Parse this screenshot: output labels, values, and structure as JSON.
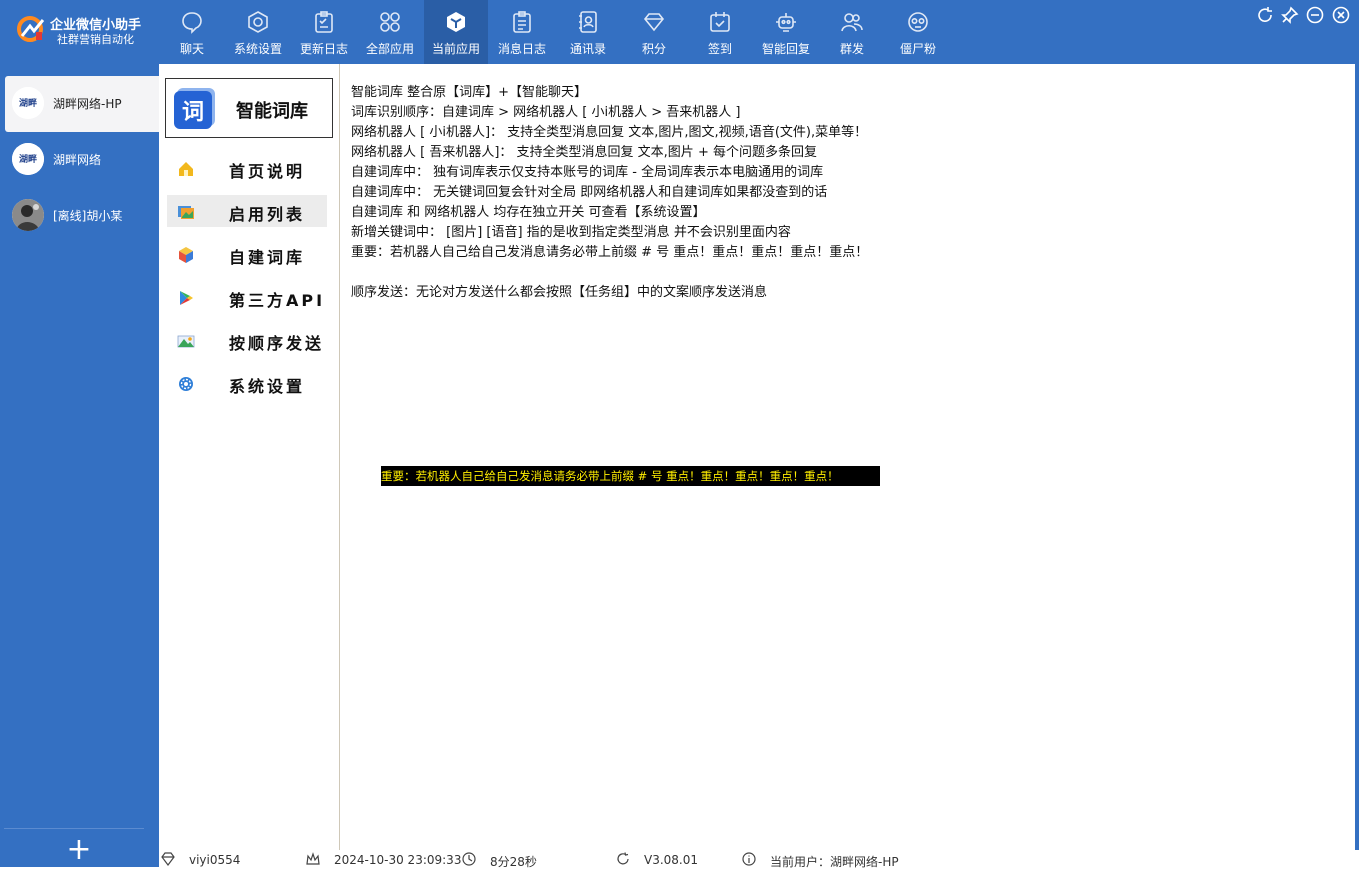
{
  "app": {
    "title": "企业微信小助手",
    "subtitle": "社群营销自动化"
  },
  "nav": [
    {
      "label": "聊天",
      "icon": "chat-bubble-icon"
    },
    {
      "label": "系统设置",
      "icon": "settings-hexagon-icon"
    },
    {
      "label": "更新日志",
      "icon": "clipboard-check-icon"
    },
    {
      "label": "全部应用",
      "icon": "apps-grid-icon"
    },
    {
      "label": "当前应用",
      "icon": "cube-icon",
      "active": true
    },
    {
      "label": "消息日志",
      "icon": "message-log-icon"
    },
    {
      "label": "通讯录",
      "icon": "contacts-icon"
    },
    {
      "label": "积分",
      "icon": "diamond-icon"
    },
    {
      "label": "签到",
      "icon": "calendar-check-icon"
    },
    {
      "label": "智能回复",
      "icon": "robot-icon"
    },
    {
      "label": "群发",
      "icon": "group-users-icon"
    },
    {
      "label": "僵尸粉",
      "icon": "zombie-face-icon"
    }
  ],
  "accounts": [
    {
      "name": "湖畔网络-HP",
      "avatar_text": "湖畔",
      "active": true
    },
    {
      "name": "湖畔网络",
      "avatar_text": "湖畔"
    },
    {
      "name": "[离线]胡小某",
      "avatar_text": ""
    }
  ],
  "module": {
    "icon_char": "词",
    "title": "智能词库"
  },
  "menu": [
    {
      "label": "首页说明",
      "icon": "home-icon"
    },
    {
      "label": "启用列表",
      "icon": "list-image-icon",
      "selected": true
    },
    {
      "label": "自建词库",
      "icon": "package-icon"
    },
    {
      "label": "第三方API",
      "icon": "play-store-icon"
    },
    {
      "label": "按顺序发送",
      "icon": "mountain-image-icon"
    },
    {
      "label": "系统设置",
      "icon": "gear-icon"
    }
  ],
  "content": {
    "lines": [
      "智能词库  整合原【词库】+【智能聊天】",
      "词库识别顺序：自建词库 > 网络机器人 [ 小i机器人 > 吾来机器人 ]",
      "网络机器人 [ 小i机器人]：  支持全类型消息回复 文本,图片,图文,视频,语音(文件),菜单等！",
      "网络机器人 [ 吾来机器人]：  支持全类型消息回复 文本,图片 + 每个问题多条回复",
      "自建词库中：  独有词库表示仅支持本账号的词库 - 全局词库表示本电脑通用的词库",
      "自建词库中：  无关键词回复会针对全局 即网络机器人和自建词库如果都没查到的话",
      "自建词库 和 网络机器人 均存在独立开关 可查看【系统设置】",
      "新增关键词中：  [图片] [语音] 指的是收到指定类型消息 并不会识别里面内容",
      "重要：若机器人自己给自己发消息请务必带上前缀 # 号 重点！重点！重点！重点！重点！"
    ],
    "sequential_note": "顺序发送：无论对方发送什么都会按照【任务组】中的文案顺序发送消息",
    "banner": "重要：若机器人自己给自己发消息请务必带上前缀 # 号 重点！重点！重点！重点！重点！"
  },
  "status": {
    "user_id": "viyi0554",
    "datetime": "2024-10-30 23:09:33",
    "elapsed": "8分28秒",
    "version": "V3.08.01",
    "current_user": "当前用户：湖畔网络-HP"
  },
  "colors": {
    "brand_blue": "#3470c2",
    "active_tab": "#2a5ea6",
    "banner_bg": "#000000",
    "banner_text": "#ffee00"
  }
}
